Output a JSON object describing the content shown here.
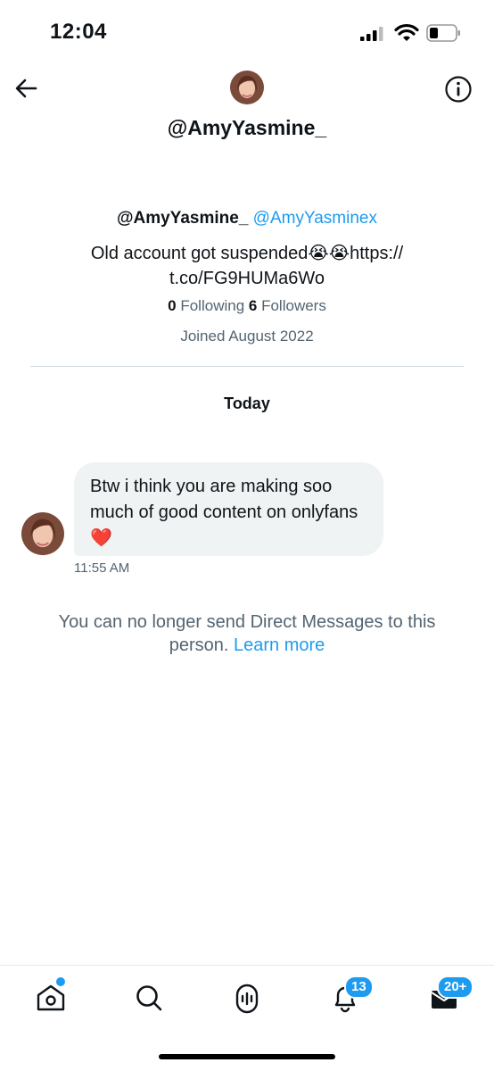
{
  "status_bar": {
    "time": "12:04"
  },
  "header": {
    "title": "@AmyYasmine_",
    "back_icon": "arrow-left-icon",
    "info_icon": "info-circle-icon"
  },
  "profile": {
    "display_name": "@AmyYasmine_",
    "handle": "@AmyYasminex",
    "bio_line1": "Old account got suspended😭😭https://",
    "bio_line2": "t.co/FG9HUMa6Wo",
    "following_count": "0",
    "following_label": "Following",
    "followers_count": "6",
    "followers_label": "Followers",
    "joined": "Joined August 2022"
  },
  "conversation": {
    "date_separator": "Today",
    "messages": [
      {
        "text": "Btw i think you are making soo much of good content on onlyfans ❤️",
        "time": "11:55 AM"
      }
    ],
    "notice_text": "You can no longer send Direct Messages to this person.",
    "notice_link": "Learn more"
  },
  "tab_bar": {
    "items": [
      {
        "icon": "home-icon",
        "has_dot": true
      },
      {
        "icon": "search-icon"
      },
      {
        "icon": "spaces-icon"
      },
      {
        "icon": "notifications-icon",
        "badge": "13"
      },
      {
        "icon": "messages-icon",
        "badge": "20+"
      }
    ]
  },
  "colors": {
    "accent": "#1d9bf0",
    "secondary_text": "#536471",
    "bubble": "#eff3f4"
  }
}
